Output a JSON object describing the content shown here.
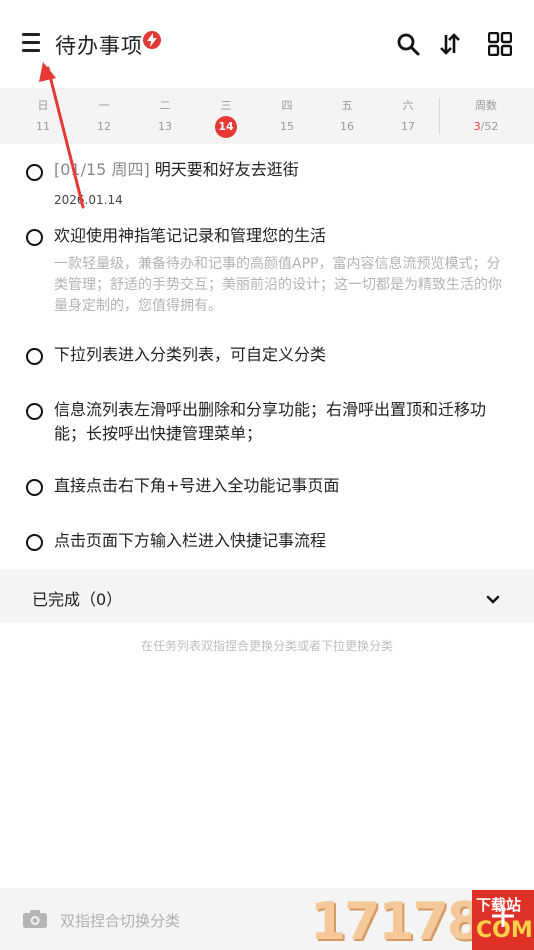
{
  "header": {
    "title": "待办事项",
    "icons": [
      "menu-icon",
      "search-icon",
      "sort-icon",
      "grid-icon"
    ]
  },
  "week": {
    "days": [
      {
        "weekday": "日",
        "date": "11"
      },
      {
        "weekday": "一",
        "date": "12"
      },
      {
        "weekday": "二",
        "date": "13"
      },
      {
        "weekday": "三",
        "date": "14",
        "today": true
      },
      {
        "weekday": "四",
        "date": "15"
      },
      {
        "weekday": "五",
        "date": "16"
      },
      {
        "weekday": "六",
        "date": "17"
      }
    ],
    "weeknum_label": "周数",
    "weeknum_current": "3",
    "weeknum_total": "/52"
  },
  "tasks": [
    {
      "prefix": "[01/15 周四]",
      "title": "明天要和好友去逛街",
      "sub": "2026.01.14"
    },
    {
      "title": "欢迎使用神指笔记记录和管理您的生活",
      "desc": "一款轻量级，兼备待办和记事的高颜值APP，富内容信息流预览模式；分类管理；舒适的手势交互；美丽前沿的设计；这一切都是为精致生活的你量身定制的，您值得拥有。"
    },
    {
      "title": "下拉列表进入分类列表，可自定义分类"
    },
    {
      "title": "信息流列表左滑呼出删除和分享功能；右滑呼出置顶和迁移功能；长按呼出快捷管理菜单；"
    },
    {
      "title": "直接点击右下角+号进入全功能记事页面"
    },
    {
      "title": "点击页面下方输入栏进入快捷记事流程"
    }
  ],
  "completed": {
    "label": "已完成（0）"
  },
  "hint": "在任务列表双指捏合更换分类或者下拉更换分类",
  "bottom": {
    "placeholder": "双指捏合切换分类",
    "watermark_number": "17178",
    "watermark_top": "下载站",
    "watermark_bottom": "COM"
  },
  "colors": {
    "accent": "#e53935",
    "arrow": "#e53935"
  }
}
